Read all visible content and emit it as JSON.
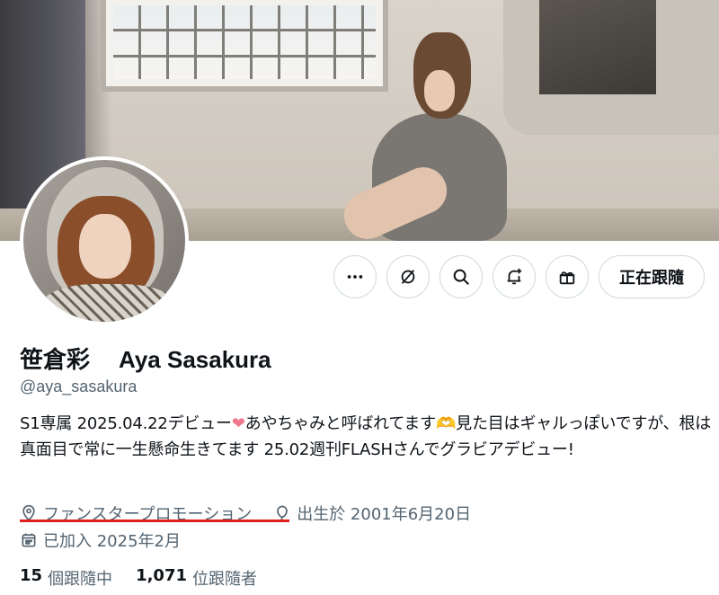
{
  "profile": {
    "display_name_jp": "笹倉彩",
    "display_name_en": "Aya Sasakura",
    "handle": "@aya_sasakura",
    "bio": {
      "part1": "S1専属 2025.04.22デビュー",
      "heart": "❤",
      "part2": "あやちゃみと呼ばれてます",
      "hands": "🫶",
      "part3": "見た目はギャルっぽいですが、根は真面目で常に一生懸命生きてます 25.02週刊FLASHさんでグラビアデビュー!"
    },
    "location": "ファンスタープロモーション",
    "birthday": "出生於 2001年6月20日",
    "joined": "已加入 2025年2月",
    "following_count": "15",
    "following_label": "個跟隨中",
    "followers_count": "1,071",
    "followers_label": "位跟隨者"
  },
  "actions": {
    "more_icon": "more-icon",
    "grok_icon": "grok-icon",
    "search_icon": "search-icon",
    "notify_icon": "bell-plus-icon",
    "gift_icon": "gift-icon",
    "follow_label": "正在跟隨"
  },
  "colors": {
    "text_primary": "#0f1419",
    "text_secondary": "#536471",
    "border": "#cfd9de",
    "annotation_underline": "#e0201f"
  }
}
